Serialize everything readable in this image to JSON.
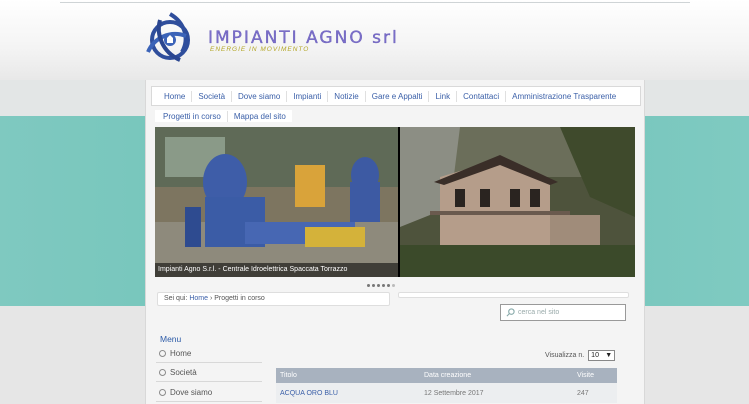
{
  "site": {
    "name": "IMPIANTI AGNO srl",
    "tagline": "ENERGIE IN MOVIMENTO"
  },
  "nav": {
    "items": [
      "Home",
      "Società",
      "Dove siamo",
      "Impianti",
      "Notizie",
      "Gare e Appalti",
      "Link",
      "Contattaci",
      "Amministrazione Trasparente"
    ],
    "secondary": [
      "Progetti in corso",
      "Mappa del sito"
    ]
  },
  "slider": {
    "caption": "Impianti Agno S.r.l. - Centrale Idroelettrica Spaccata Torrazzo",
    "dot_count": 6,
    "active_dot": 5
  },
  "breadcrumb": {
    "prefix": "Sei qui:",
    "home": "Home",
    "separator": "›",
    "current": "Progetti in corso"
  },
  "search": {
    "placeholder": "cerca nel sito"
  },
  "sidebar": {
    "title": "Menu",
    "items": [
      "Home",
      "Società",
      "Dove siamo"
    ]
  },
  "table": {
    "display_label": "Visualizza n.",
    "display_value": "10",
    "headers": [
      "Titolo",
      "Data creazione",
      "Visite"
    ],
    "rows": [
      [
        "ACQUA ORO BLU",
        "12 Settembre 2017",
        "247"
      ]
    ]
  },
  "colors": {
    "link": "#3a5fa8",
    "teal_band": "#6ec3b8",
    "table_header": "#a8b2bf",
    "logo_purple": "#7b6fc9",
    "tagline_gold": "#b3a627"
  }
}
